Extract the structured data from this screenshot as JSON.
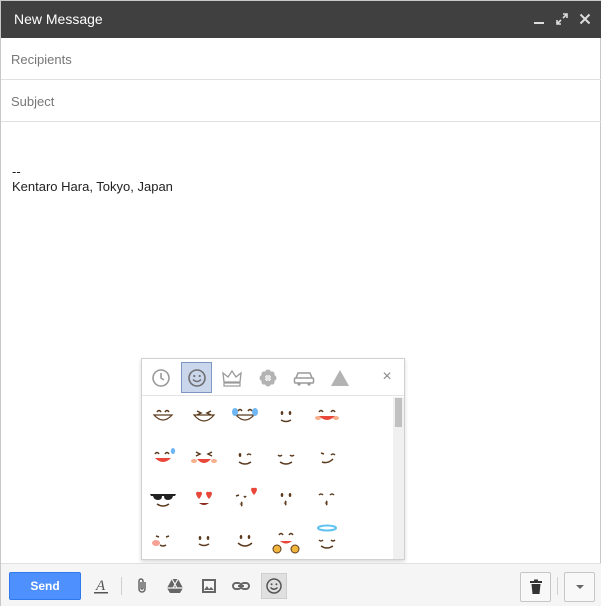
{
  "window": {
    "title": "New Message"
  },
  "titlebar_icons": [
    "minimize-icon",
    "maximize-icon",
    "close-icon"
  ],
  "fields": {
    "recipients_placeholder": "Recipients",
    "subject_placeholder": "Subject"
  },
  "body": {
    "signature_separator": "--",
    "signature": "Kentaro Hara, Tokyo, Japan"
  },
  "emoji_picker": {
    "tabs": [
      "recent-icon",
      "smiley-icon",
      "crown-icon",
      "flower-icon",
      "car-icon",
      "triangle-icon"
    ],
    "selected_tab": "smiley-icon",
    "close_label": "×",
    "emojis": [
      "grinning-face",
      "grinning-squinting-teeth",
      "tears-of-joy",
      "slightly-smiling-blush",
      "smiling-happy",
      "sweat-smile",
      "squinting-laughing",
      "winking-face",
      "relieved-face",
      "smirking-wink",
      "sunglasses-face",
      "heart-eyes",
      "kissing-heart",
      "kissing-face",
      "kissing-closed-eyes",
      "hugging-blush",
      "slightly-smiling",
      "smiling-face",
      "hugging-hands",
      "halo-face"
    ]
  },
  "toolbar": {
    "send_label": "Send",
    "tools": [
      "formatting-icon",
      "attach-icon",
      "drive-icon",
      "photo-icon",
      "link-icon",
      "emoji-icon"
    ],
    "active_tool": "emoji-icon"
  },
  "colors": {
    "titlebar": "#404040",
    "send_button": "#4d90fe",
    "emoji_yellow": "#f9c23c",
    "selected_tab": "#c9d6eb"
  }
}
